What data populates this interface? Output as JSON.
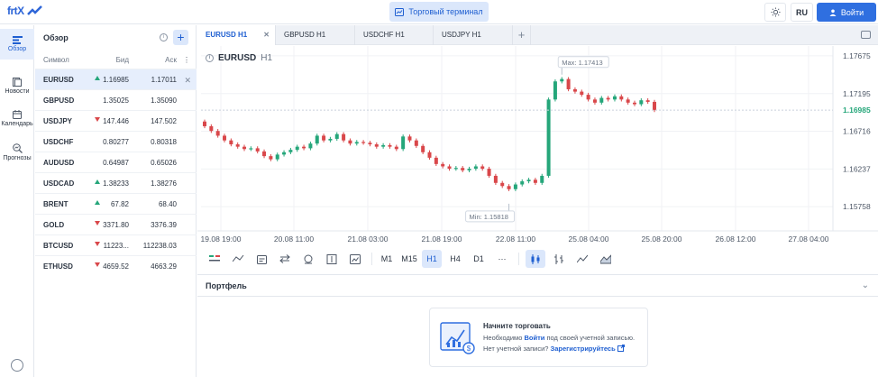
{
  "header": {
    "logo_text": "frtX",
    "terminal_label": "Торговый терминал",
    "language": "RU",
    "login_label": "Войти"
  },
  "nav": {
    "items": [
      {
        "label": "Обзор",
        "icon": "overview-icon"
      },
      {
        "label": "Новости",
        "icon": "news-icon"
      },
      {
        "label": "Календарь",
        "icon": "calendar-icon"
      },
      {
        "label": "Прогнозы",
        "icon": "forecast-icon"
      }
    ]
  },
  "overview": {
    "title": "Обзор",
    "columns": {
      "symbol": "Символ",
      "bid": "Бид",
      "ask": "Аск"
    },
    "rows": [
      {
        "symbol": "EURUSD",
        "dir": "up",
        "bid": "1.16985",
        "ask": "1.17011",
        "selected": true
      },
      {
        "symbol": "GBPUSD",
        "dir": "",
        "bid": "1.35025",
        "ask": "1.35090"
      },
      {
        "symbol": "USDJPY",
        "dir": "down",
        "bid": "147.446",
        "ask": "147.502"
      },
      {
        "symbol": "USDCHF",
        "dir": "",
        "bid": "0.80277",
        "ask": "0.80318"
      },
      {
        "symbol": "AUDUSD",
        "dir": "",
        "bid": "0.64987",
        "ask": "0.65026"
      },
      {
        "symbol": "USDCAD",
        "dir": "up",
        "bid": "1.38233",
        "ask": "1.38276"
      },
      {
        "symbol": "BRENT",
        "dir": "up",
        "bid": "67.82",
        "ask": "68.40"
      },
      {
        "symbol": "GOLD",
        "dir": "down",
        "bid": "3371.80",
        "ask": "3376.39"
      },
      {
        "symbol": "BTCUSD",
        "dir": "down",
        "bid": "11223...",
        "ask": "112238.03"
      },
      {
        "symbol": "ETHUSD",
        "dir": "down",
        "bid": "4659.52",
        "ask": "4663.29"
      }
    ]
  },
  "tabs": [
    {
      "label": "EURUSD H1",
      "active": true
    },
    {
      "label": "GBPUSD H1"
    },
    {
      "label": "USDCHF H1"
    },
    {
      "label": "USDJPY H1"
    }
  ],
  "chart": {
    "symbol": "EURUSD",
    "timeframe": "H1",
    "max_label": "Max: 1.17413",
    "min_label": "Min: 1.15818",
    "current_price": "1.16985",
    "colors": {
      "up": "#25a67a",
      "down": "#d9474a"
    }
  },
  "chart_data": {
    "type": "candlestick",
    "y_ticks": [
      "1.17675",
      "1.17195",
      "1.16716",
      "1.16237",
      "1.15758"
    ],
    "y_range": [
      1.1545,
      1.178
    ],
    "x_ticks": [
      "19.08 19:00",
      "20.08 11:00",
      "21.08 03:00",
      "21.08 19:00",
      "22.08 11:00",
      "25.08 04:00",
      "25.08 20:00",
      "26.08 12:00",
      "27.08 04:00"
    ],
    "close": [
      1.1678,
      1.1672,
      1.1666,
      1.166,
      1.1655,
      1.1652,
      1.1649,
      1.165,
      1.1646,
      1.164,
      1.1636,
      1.1642,
      1.1645,
      1.1648,
      1.1652,
      1.165,
      1.1656,
      1.1666,
      1.166,
      1.1662,
      1.1668,
      1.166,
      1.1656,
      1.1658,
      1.1657,
      1.1655,
      1.1652,
      1.1654,
      1.1652,
      1.1649,
      1.1665,
      1.166,
      1.1653,
      1.1645,
      1.1638,
      1.163,
      1.1627,
      1.1624,
      1.1625,
      1.1622,
      1.1624,
      1.1627,
      1.1624,
      1.1615,
      1.1606,
      1.1602,
      1.1598,
      1.1604,
      1.1608,
      1.161,
      1.1606,
      1.1615,
      1.1712,
      1.1735,
      1.1738,
      1.1725,
      1.1722,
      1.1718,
      1.1712,
      1.1708,
      1.1714,
      1.1712,
      1.1716,
      1.1712,
      1.1708,
      1.1706,
      1.1711,
      1.1709,
      1.16985
    ]
  },
  "toolbar": {
    "timeframes": [
      "M1",
      "M15",
      "H1",
      "H4",
      "D1"
    ],
    "more": "···",
    "active_timeframe": "H1"
  },
  "portfolio": {
    "title": "Портфель",
    "card_title": "Начните торговать",
    "line1_prefix": "Необходимо",
    "line1_link": "Войти",
    "line1_suffix": "под своей учетной записью.",
    "line2_prefix": "Нет учетной записи?",
    "line2_link": "Зарегистрируйтесь"
  }
}
